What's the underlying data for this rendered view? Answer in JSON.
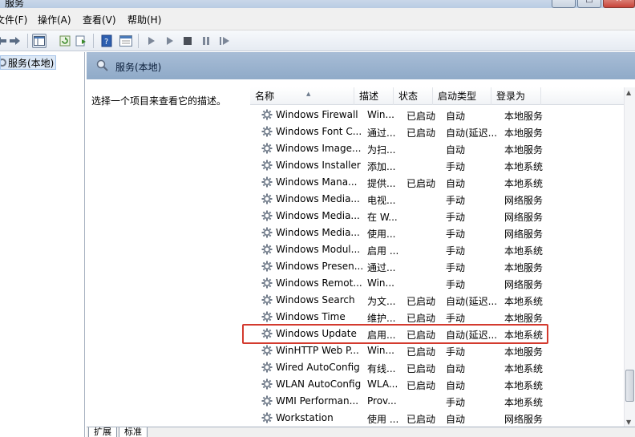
{
  "window": {
    "title": "服务",
    "min": "–",
    "max": "□",
    "close": "✕"
  },
  "menu": [
    "文件(F)",
    "操作(A)",
    "查看(V)",
    "帮助(H)"
  ],
  "tree": {
    "item": "服务(本地)"
  },
  "pane": {
    "title": "服务(本地)",
    "description": "选择一个项目来查看它的描述。"
  },
  "columns": [
    "名称",
    "描述",
    "状态",
    "启动类型",
    "登录为"
  ],
  "rows": [
    {
      "name": "Windows Firewall",
      "desc": "Win...",
      "status": "已启动",
      "start": "自动",
      "logon": "本地服务"
    },
    {
      "name": "Windows Font C...",
      "desc": "通过...",
      "status": "已启动",
      "start": "自动(延迟...",
      "logon": "本地服务"
    },
    {
      "name": "Windows Image...",
      "desc": "为扫...",
      "status": "",
      "start": "自动",
      "logon": "本地服务"
    },
    {
      "name": "Windows Installer",
      "desc": "添加...",
      "status": "",
      "start": "手动",
      "logon": "本地系统"
    },
    {
      "name": "Windows Mana...",
      "desc": "提供...",
      "status": "已启动",
      "start": "自动",
      "logon": "本地系统"
    },
    {
      "name": "Windows Media...",
      "desc": "电视...",
      "status": "",
      "start": "手动",
      "logon": "网络服务"
    },
    {
      "name": "Windows Media...",
      "desc": "在 W...",
      "status": "",
      "start": "手动",
      "logon": "网络服务"
    },
    {
      "name": "Windows Media...",
      "desc": "使用...",
      "status": "",
      "start": "手动",
      "logon": "网络服务"
    },
    {
      "name": "Windows Modul...",
      "desc": "启用 ...",
      "status": "",
      "start": "手动",
      "logon": "本地系统"
    },
    {
      "name": "Windows Presen...",
      "desc": "通过...",
      "status": "",
      "start": "手动",
      "logon": "本地服务"
    },
    {
      "name": "Windows Remot...",
      "desc": "Win...",
      "status": "",
      "start": "手动",
      "logon": "网络服务"
    },
    {
      "name": "Windows Search",
      "desc": "为文...",
      "status": "已启动",
      "start": "自动(延迟...",
      "logon": "本地系统"
    },
    {
      "name": "Windows Time",
      "desc": "维护...",
      "status": "已启动",
      "start": "手动",
      "logon": "本地服务"
    },
    {
      "name": "Windows Update",
      "desc": "启用...",
      "status": "已启动",
      "start": "自动(延迟...",
      "logon": "本地系统",
      "highlighted": true
    },
    {
      "name": "WinHTTP Web P...",
      "desc": "Win...",
      "status": "已启动",
      "start": "手动",
      "logon": "本地服务"
    },
    {
      "name": "Wired AutoConfig",
      "desc": "有线...",
      "status": "已启动",
      "start": "自动",
      "logon": "本地系统"
    },
    {
      "name": "WLAN AutoConfig",
      "desc": "WLA...",
      "status": "已启动",
      "start": "自动",
      "logon": "本地系统"
    },
    {
      "name": "WMI Performan...",
      "desc": "Prov...",
      "status": "",
      "start": "手动",
      "logon": "本地系统"
    },
    {
      "name": "Workstation",
      "desc": "使用 ...",
      "status": "已启动",
      "start": "自动",
      "logon": "网络服务"
    }
  ],
  "tabs": [
    "扩展",
    "标准"
  ],
  "colors": {
    "highlight_border": "#d33a2e",
    "header_bg": "#9fb6d1"
  }
}
